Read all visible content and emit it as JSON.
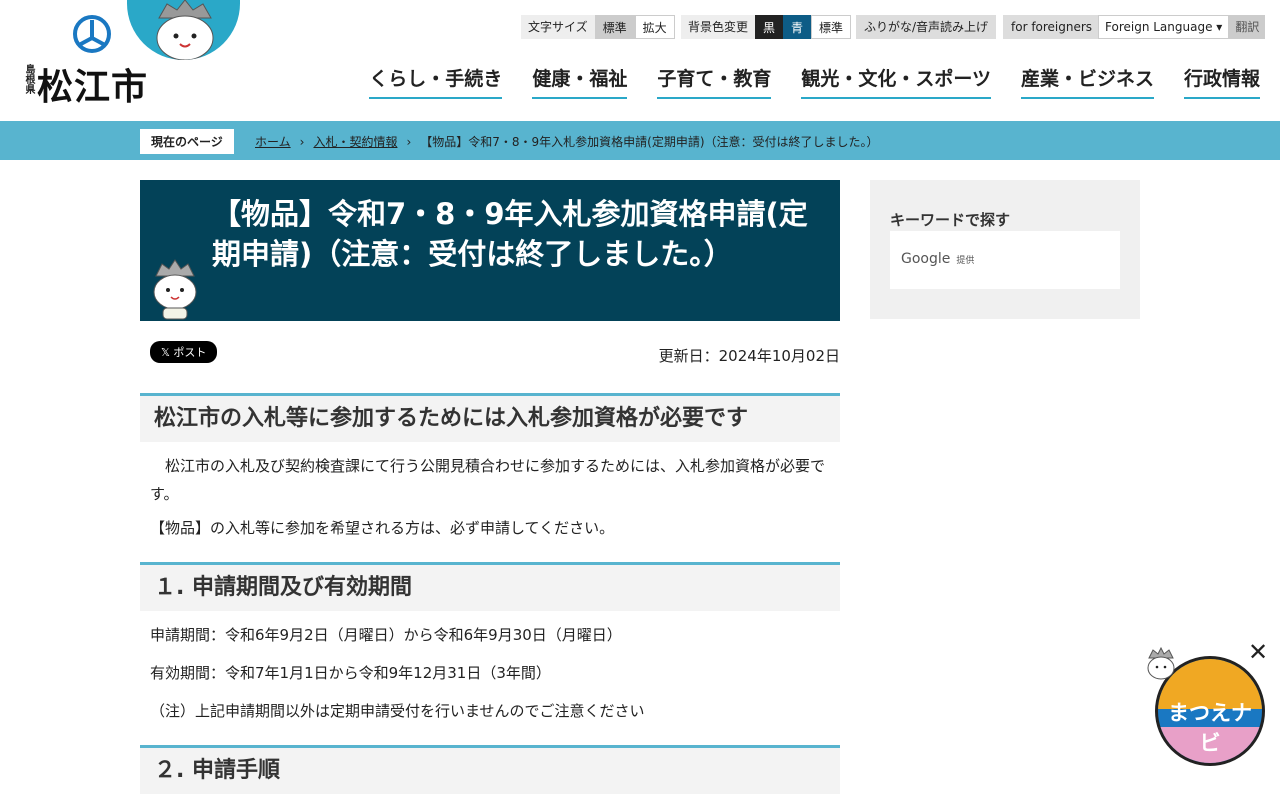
{
  "header": {
    "logo_pref": "島根県",
    "logo_city": "松江市",
    "font_size_label": "文字サイズ",
    "font_size_normal": "標準",
    "font_size_large": "拡大",
    "bg_label": "背景色変更",
    "bg_black": "黒",
    "bg_blue": "青",
    "bg_standard": "標準",
    "furigana": "ふりがな/音声読み上げ",
    "foreigners": "for foreigners",
    "foreign_language": "Foreign Language",
    "translate": "翻訳"
  },
  "nav": [
    "くらし・手続き",
    "健康・福祉",
    "子育て・教育",
    "観光・文化・スポーツ",
    "産業・ビジネス",
    "行政情報"
  ],
  "breadcrumb": {
    "current_label": "現在のページ",
    "items": [
      "ホーム",
      "入札・契約情報",
      "【物品】令和7・8・9年入札参加資格申請(定期申請)（注意：受付は終了しました。）"
    ]
  },
  "page": {
    "title": "【物品】令和7・8・9年入札参加資格申請(定期申請)（注意：受付は終了しました。）",
    "x_post": "𝕏 ポスト",
    "updated": "更新日：2024年10月02日",
    "sections": [
      {
        "heading": "松江市の入札等に参加するためには入札参加資格が必要です",
        "paras": [
          "　松江市の入札及び契約検査課にて行う公開見積合わせに参加するためには、入札参加資格が必要です。",
          "【物品】の入札等に参加を希望される方は、必ず申請してください。"
        ]
      },
      {
        "heading": "１. 申請期間及び有効期間",
        "paras": [
          "申請期間：令和6年9月2日（月曜日）から令和6年9月30日（月曜日）",
          "有効期間：令和7年1月1日から令和9年12月31日（3年間）",
          "（注）上記申請期間以外は定期申請受付を行いませんのでご注意ください"
        ]
      },
      {
        "heading": "２. 申請手順",
        "paras": []
      }
    ]
  },
  "sidebar": {
    "keyword_title": "キーワードで探す",
    "google": "Google",
    "provided": "提供"
  },
  "navi_widget": {
    "label": "まつえナビ",
    "close": "✕"
  }
}
